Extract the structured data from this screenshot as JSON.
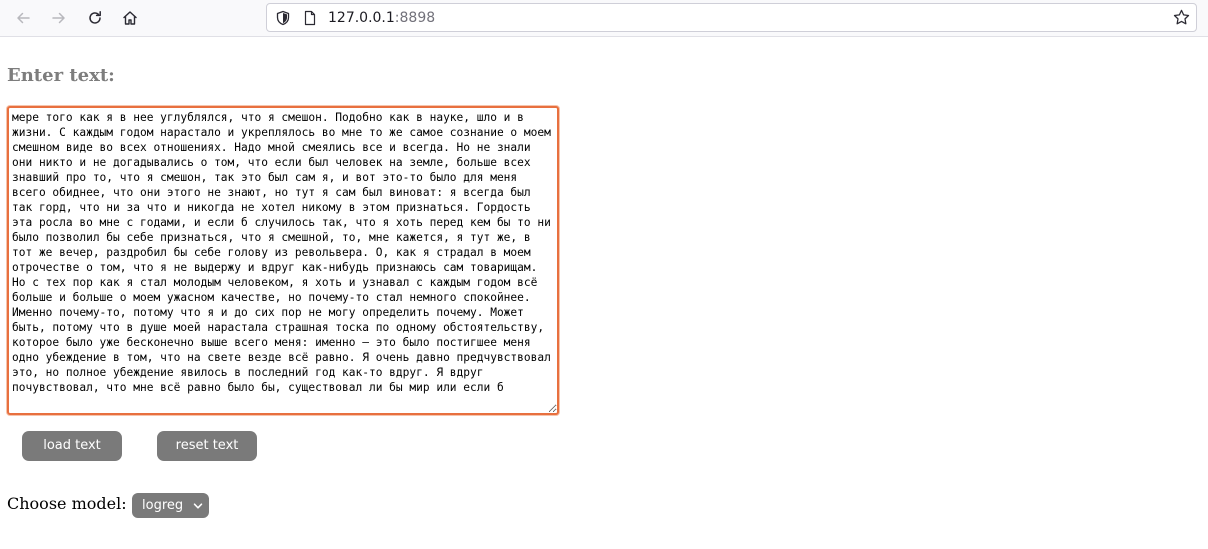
{
  "browser": {
    "url_host": "127.0.0.1",
    "url_port": ":8898",
    "icons": [
      "back-arrow-icon",
      "forward-arrow-icon",
      "reload-icon",
      "home-icon",
      "shield-icon",
      "page-icon",
      "star-icon"
    ]
  },
  "page": {
    "heading": "Enter text:",
    "textarea_text": "мере того как я в нее углублялся, что я смешон. Подобно как в науке, шло и в жизни. С каждым годом нарастало и укреплялось во мне то же самое сознание о моем смешном виде во всех отношениях. Надо мной смеялись все и всегда. Но не знали они никто и не догадывались о том, что если был человек на земле, больше всех знавший про то, что я смешон, так это был сам я, и вот это-то было для меня всего обиднее, что они этого не знают, но тут я сам был виноват: я всегда был так горд, что ни за что и никогда не хотел никому в этом признаться. Гордость эта росла во мне с годами, и если б случилось так, что я хоть перед кем бы то ни было позволил бы себе признаться, что я смешной, то, мне кажется, я тут же, в тот же вечер, раздробил бы себе голову из револьвера. О, как я страдал в моем отрочестве о том, что я не выдержу и вдруг как-нибудь признаюсь сам товарищам. Но с тех пор как я стал молодым человеком, я хоть и узнавал с каждым годом всё больше и больше о моем ужасном качестве, но почему-то стал немного спокойнее. Именно почему-то, потому что я и до сих пор не могу определить почему. Может быть, потому что в душе моей нарастала страшная тоска по одному обстоятельству, которое было уже бесконечно выше всего меня: именно — это было постигшее меня одно убеждение в том, что на свете везде всё равно. Я очень давно предчувствовал это, но полное убеждение явилось в последний год как-то вдруг. Я вдруг почувствовал, что мне всё равно было бы, существовал ли бы мир или если б",
    "load_button": "load text",
    "reset_button": "reset text",
    "model_label": "Choose model:",
    "model_selected": "logreg"
  },
  "colors": {
    "button_bg": "#7a7a7a",
    "textarea_focus": "#e8703f",
    "heading": "#7d7d7d"
  }
}
